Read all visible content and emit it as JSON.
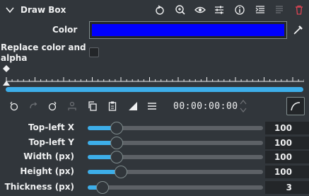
{
  "header": {
    "title": "Draw Box",
    "icons": [
      "chevron-down-icon",
      "reset-icon",
      "zoom-icon",
      "eye-icon",
      "sliders-icon",
      "info-icon",
      "list-icon",
      "disabled-icon",
      "trash-icon"
    ]
  },
  "color_row": {
    "label": "Color",
    "color": "#0000ff"
  },
  "replace_row": {
    "label_line1": "Replace color and",
    "label_line2": "alpha",
    "checked": false
  },
  "timeline": {
    "progress_fraction": 1.0
  },
  "toolbar": {
    "timecode": "00:00:00:00"
  },
  "params": [
    {
      "label": "Top-left X",
      "value": "100",
      "fraction": 0.09
    },
    {
      "label": "Top-left Y",
      "value": "100",
      "fraction": 0.09
    },
    {
      "label": "Width (px)",
      "value": "100",
      "fraction": 0.09
    },
    {
      "label": "Height (px)",
      "value": "100",
      "fraction": 0.12
    },
    {
      "label": "Thickness (px)",
      "value": "3",
      "fraction": 0.0
    }
  ],
  "colors": {
    "accent": "#3daee9",
    "background": "#31363b",
    "field": "#232629",
    "danger": "#da4453"
  }
}
